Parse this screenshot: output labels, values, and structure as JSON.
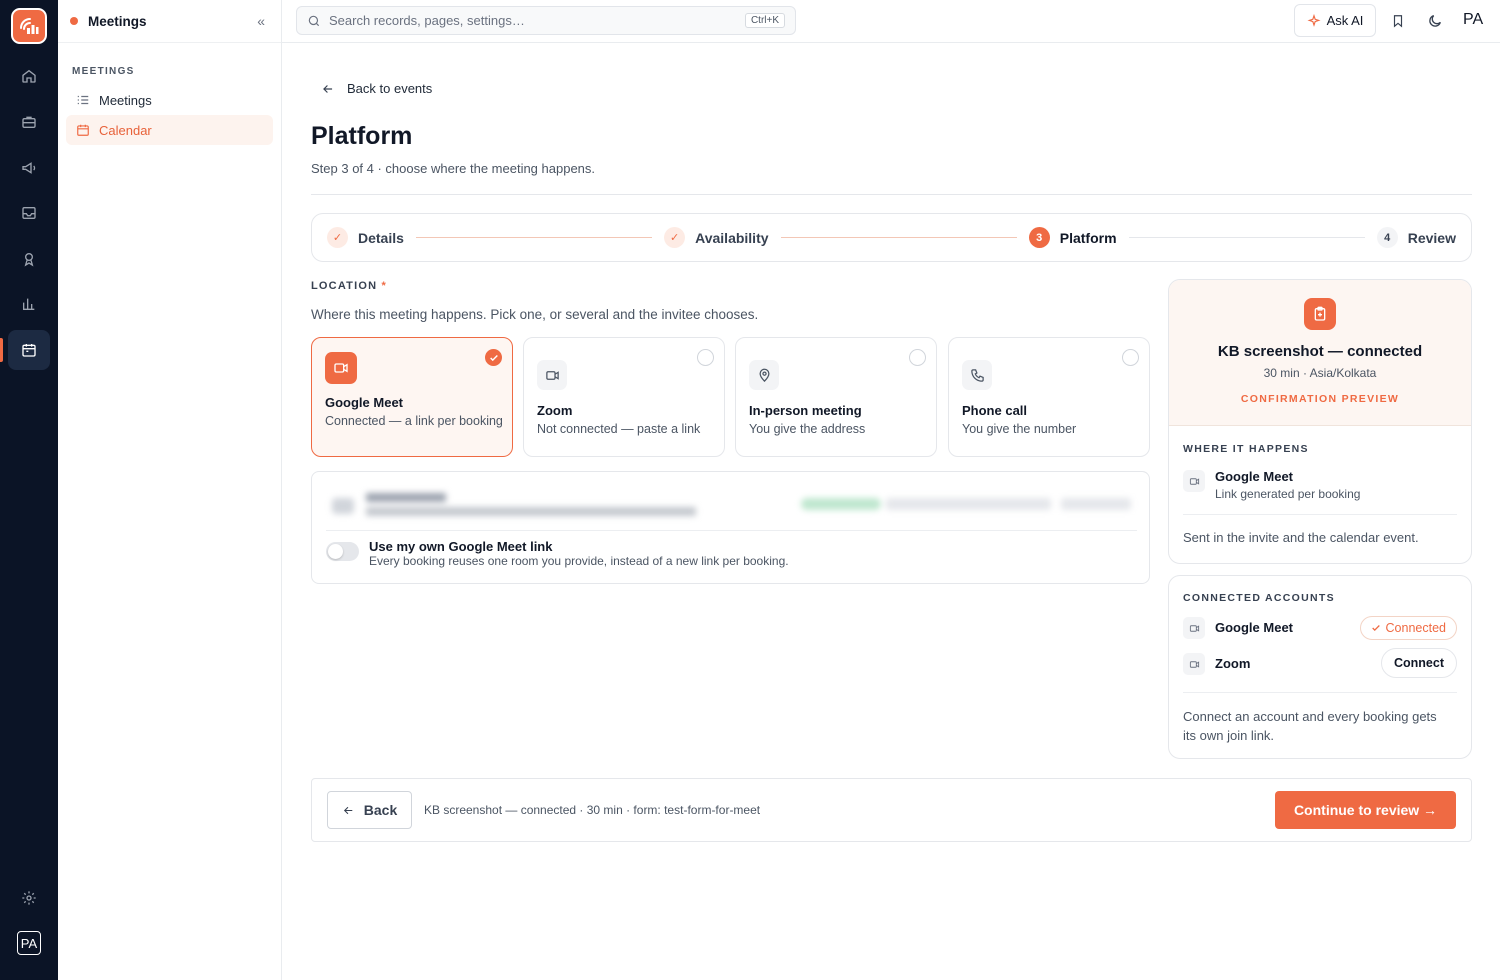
{
  "app": {
    "section_title": "Meetings"
  },
  "sidebar": {
    "section_label": "MEETINGS",
    "items": [
      {
        "label": "Meetings",
        "icon": "list-icon",
        "active": false
      },
      {
        "label": "Calendar",
        "icon": "calendar-icon",
        "active": true
      }
    ]
  },
  "topbar": {
    "search_placeholder": "Search records, pages, settings…",
    "search_shortcut": "Ctrl+K",
    "ask_ai_label": "Ask AI",
    "user_initials": "PA"
  },
  "rail": {
    "items": [
      "home-icon",
      "briefcase-icon",
      "megaphone-icon",
      "inbox-icon",
      "trophy-icon",
      "chart-icon",
      "calendar-icon"
    ],
    "active_item": "calendar-icon",
    "user_initials": "PA"
  },
  "page": {
    "back_label": "Back to events",
    "title": "Platform",
    "subtitle": "Step 3 of 4 · choose where the meeting happens."
  },
  "stepper": {
    "steps": [
      {
        "label": "Details",
        "state": "done",
        "badge": "✓"
      },
      {
        "label": "Availability",
        "state": "done",
        "badge": "✓"
      },
      {
        "label": "Platform",
        "state": "current",
        "badge": "3"
      },
      {
        "label": "Review",
        "state": "todo",
        "badge": "4"
      }
    ]
  },
  "location": {
    "label": "LOCATION",
    "required_mark": "*",
    "help": "Where this meeting happens. Pick one, or several and the invitee chooses.",
    "options": [
      {
        "title": "Google Meet",
        "desc": "Connected — a link per booking",
        "icon": "video-icon",
        "selected": true
      },
      {
        "title": "Zoom",
        "desc": "Not connected — paste a link",
        "icon": "video-icon",
        "selected": false
      },
      {
        "title": "In-person meeting",
        "desc": "You give the address",
        "icon": "map-pin-icon",
        "selected": false
      },
      {
        "title": "Phone call",
        "desc": "You give the number",
        "icon": "phone-icon",
        "selected": false
      }
    ]
  },
  "own_link": {
    "title": "Use my own Google Meet link",
    "desc": "Every booking reuses one room you provide, instead of a new link per booking.",
    "enabled": false
  },
  "preview": {
    "name": "KB screenshot — connected",
    "meta": "30 min · Asia/Kolkata",
    "label": "CONFIRMATION PREVIEW",
    "where_title": "WHERE IT HAPPENS",
    "where_name": "Google Meet",
    "where_desc": "Link generated per booking",
    "note": "Sent in the invite and the calendar event."
  },
  "accounts": {
    "title": "CONNECTED ACCOUNTS",
    "items": [
      {
        "name": "Google Meet",
        "action": "Connected",
        "connected": true
      },
      {
        "name": "Zoom",
        "action": "Connect",
        "connected": false
      }
    ],
    "note": "Connect an account and every booking gets its own join link."
  },
  "footer": {
    "back_label": "Back",
    "summary": "KB screenshot — connected · 30 min · form: test-form-for-meet",
    "cta_label": "Continue to review →"
  },
  "colors": {
    "accent": "#ef6a43",
    "rail_bg": "#0b1426",
    "accent_soft": "#fdf6f2"
  }
}
